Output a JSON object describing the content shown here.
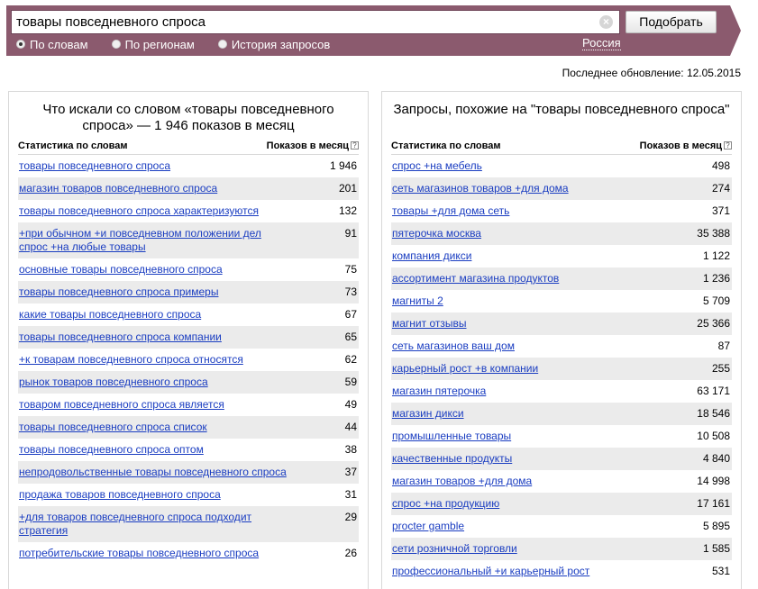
{
  "search": {
    "value": "товары повседневного спроса",
    "clear_glyph": "×",
    "submit_label": "Подобрать",
    "modes": [
      {
        "label": "По словам",
        "checked": true
      },
      {
        "label": "По регионам",
        "checked": false
      },
      {
        "label": "История запросов",
        "checked": false
      }
    ],
    "region": "Россия"
  },
  "last_update": "Последнее обновление: 12.05.2015",
  "left_panel": {
    "title": "Что искали со словом «товары повседневного спроса» — 1 946 показов в месяц",
    "col_query": "Статистика по словам",
    "col_count": "Показов в месяц",
    "help_glyph": "?",
    "rows": [
      {
        "q": "товары повседневного спроса",
        "n": "1 946"
      },
      {
        "q": "магазин товаров повседневного спроса",
        "n": "201"
      },
      {
        "q": "товары повседневного спроса характеризуются",
        "n": "132"
      },
      {
        "q": "+при обычном +и повседневном положении дел спрос +на любые товары",
        "n": "91"
      },
      {
        "q": "основные товары повседневного спроса",
        "n": "75"
      },
      {
        "q": "товары повседневного спроса примеры",
        "n": "73"
      },
      {
        "q": "какие товары повседневного спроса",
        "n": "67"
      },
      {
        "q": "товары повседневного спроса компании",
        "n": "65"
      },
      {
        "q": "+к товарам повседневного спроса относятся",
        "n": "62"
      },
      {
        "q": "рынок товаров повседневного спроса",
        "n": "59"
      },
      {
        "q": "товаром повседневного спроса является",
        "n": "49"
      },
      {
        "q": "товары повседневного спроса список",
        "n": "44"
      },
      {
        "q": "товары повседневного спроса оптом",
        "n": "38"
      },
      {
        "q": "непродовольственные товары повседневного спроса",
        "n": "37"
      },
      {
        "q": "продажа товаров повседневного спроса",
        "n": "31"
      },
      {
        "q": "+для товаров повседневного спроса подходит стратегия",
        "n": "29"
      },
      {
        "q": "потребительские товары повседневного спроса",
        "n": "26"
      }
    ]
  },
  "right_panel": {
    "title": "Запросы, похожие на \"товары повседневного спроса\"",
    "col_query": "Статистика по словам",
    "col_count": "Показов в месяц",
    "help_glyph": "?",
    "rows": [
      {
        "q": "спрос +на мебель",
        "n": "498"
      },
      {
        "q": "сеть магазинов товаров +для дома",
        "n": "274"
      },
      {
        "q": "товары +для дома сеть",
        "n": "371"
      },
      {
        "q": "пятерочка москва",
        "n": "35 388"
      },
      {
        "q": "компания дикси",
        "n": "1 122"
      },
      {
        "q": "ассортимент магазина продуктов",
        "n": "1 236"
      },
      {
        "q": "магниты 2",
        "n": "5 709"
      },
      {
        "q": "магнит отзывы",
        "n": "25 366"
      },
      {
        "q": "сеть магазинов ваш дом",
        "n": "87"
      },
      {
        "q": "карьерный рост +в компании",
        "n": "255"
      },
      {
        "q": "магазин пятерочка",
        "n": "63 171"
      },
      {
        "q": "магазин дикси",
        "n": "18 546"
      },
      {
        "q": "промышленные товары",
        "n": "10 508"
      },
      {
        "q": "качественные продукты",
        "n": "4 840"
      },
      {
        "q": "магазин товаров +для дома",
        "n": "14 998"
      },
      {
        "q": "спрос +на продукцию",
        "n": "17 161"
      },
      {
        "q": "procter gamble",
        "n": "5 895"
      },
      {
        "q": "сети розничной торговли",
        "n": "1 585"
      },
      {
        "q": "профессиональный +и карьерный рост",
        "n": "531"
      }
    ]
  }
}
